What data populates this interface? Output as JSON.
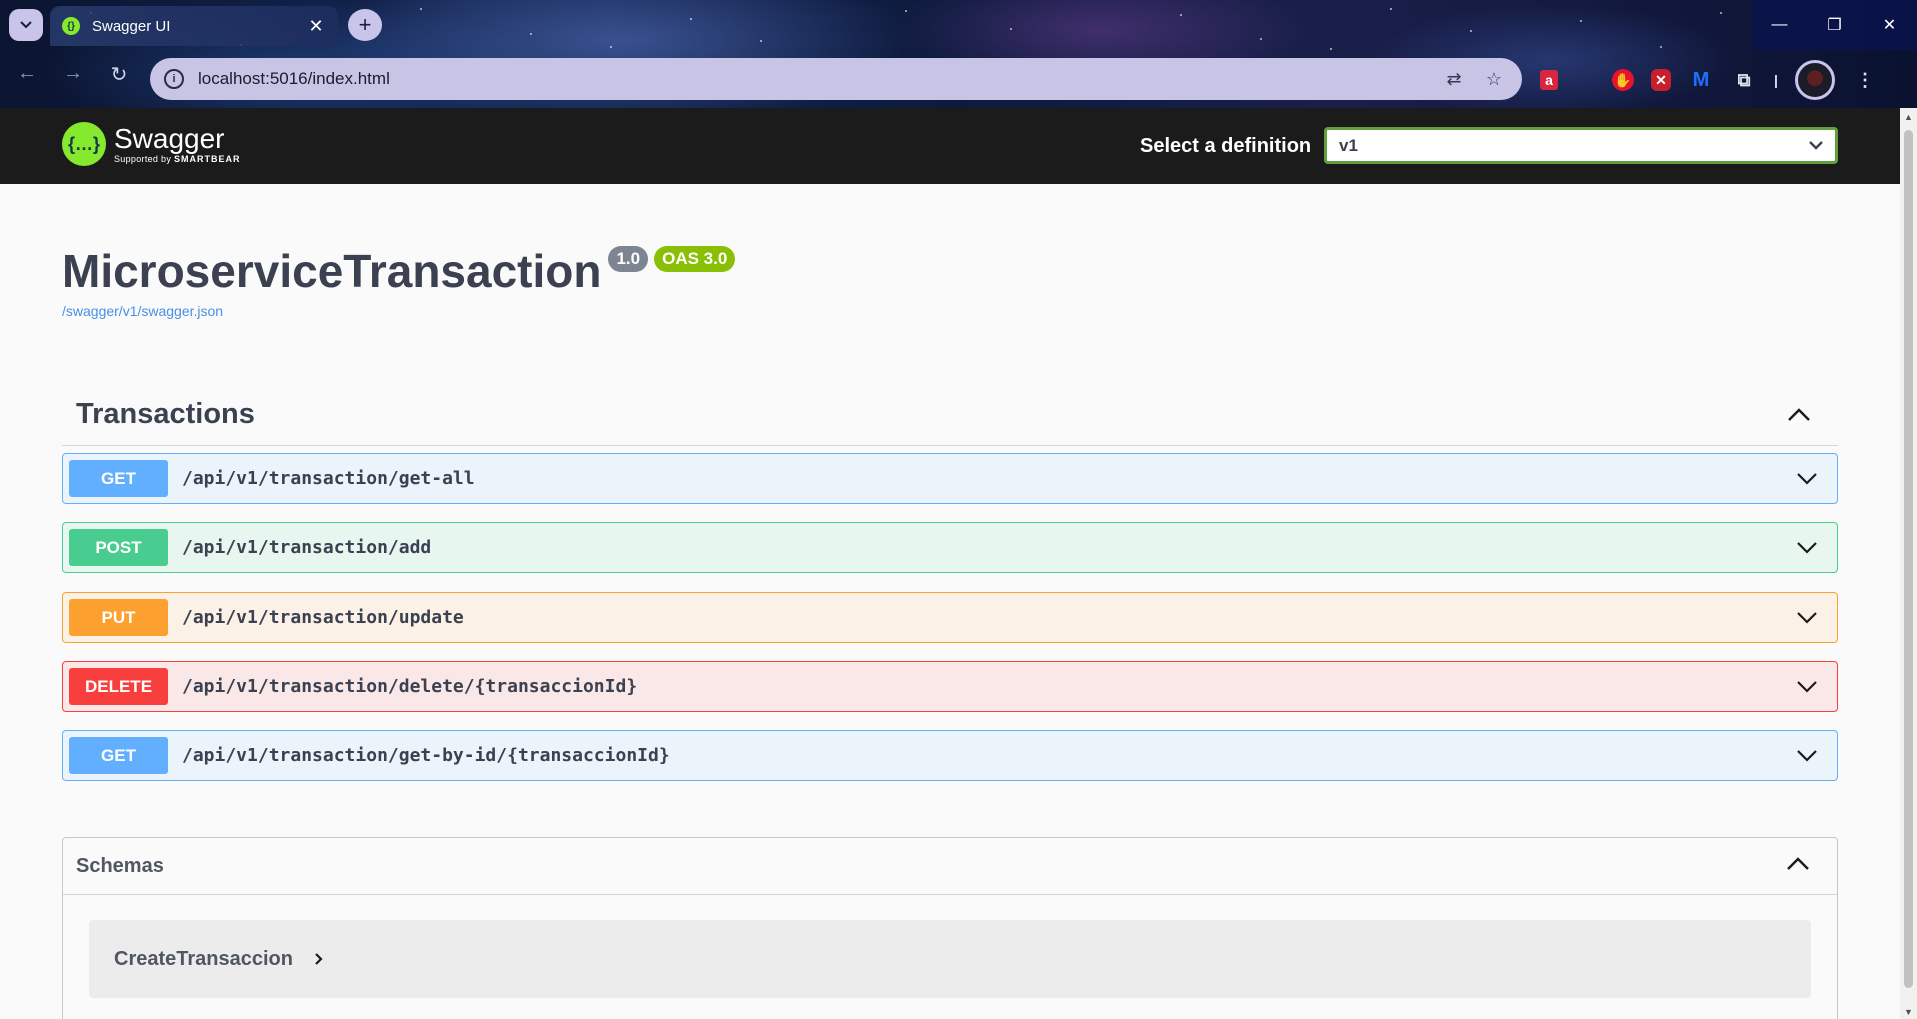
{
  "browser": {
    "tab_title": "Swagger UI",
    "url": "localhost:5016/index.html",
    "window_buttons": [
      "minimize",
      "restore",
      "close"
    ]
  },
  "topbar": {
    "logo_name": "Swagger",
    "logo_sub_prefix": "Supported by",
    "logo_sub_brand": "SMARTBEAR",
    "definition_label": "Select a definition",
    "definition_value": "v1"
  },
  "info": {
    "title": "MicroserviceTransaction",
    "version": "1.0",
    "oas": "OAS 3.0",
    "spec_link": "/swagger/v1/swagger.json"
  },
  "tag": {
    "name": "Transactions",
    "operations": [
      {
        "method": "GET",
        "path": "/api/v1/transaction/get-all"
      },
      {
        "method": "POST",
        "path": "/api/v1/transaction/add"
      },
      {
        "method": "PUT",
        "path": "/api/v1/transaction/update"
      },
      {
        "method": "DELETE",
        "path": "/api/v1/transaction/delete/{transaccionId}"
      },
      {
        "method": "GET",
        "path": "/api/v1/transaction/get-by-id/{transaccionId}"
      }
    ]
  },
  "schemas": {
    "title": "Schemas",
    "models": [
      "CreateTransaccion"
    ]
  },
  "colors": {
    "get": "#61affe",
    "post": "#49cc90",
    "put": "#fca130",
    "delete": "#f93e3e",
    "swagger_green": "#85ea2d"
  }
}
